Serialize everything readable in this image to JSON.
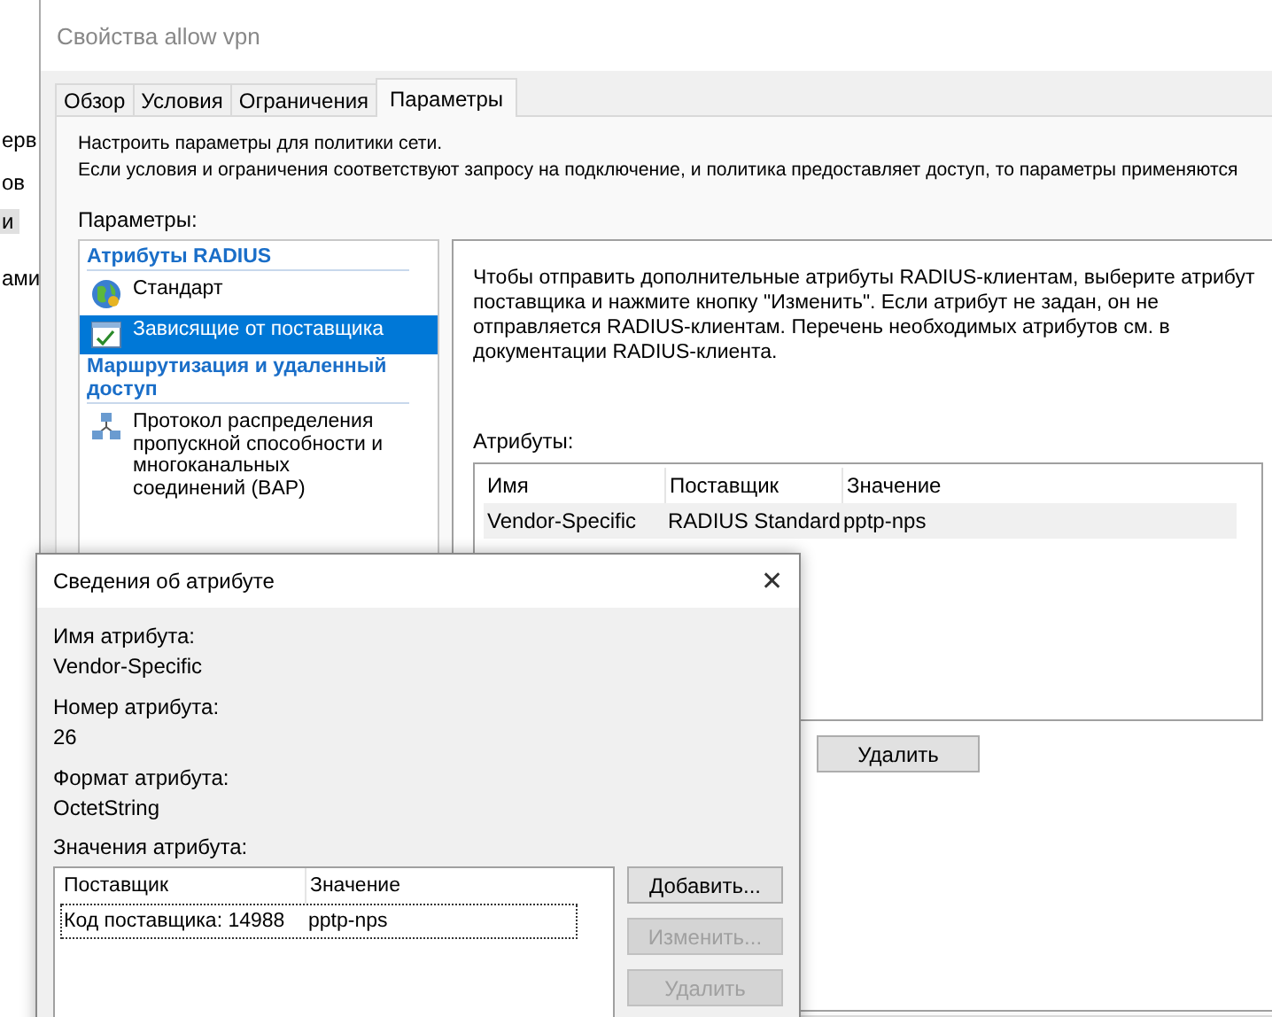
{
  "background_window": {
    "fragments": [
      {
        "text": "ерв",
        "selected": false
      },
      {
        "text": "ов",
        "selected": false
      },
      {
        "text": "и",
        "selected": true
      },
      {
        "text": "ами",
        "selected": false
      }
    ]
  },
  "window": {
    "title": "Свойства allow vpn",
    "tabs": [
      {
        "label": "Обзор",
        "selected": false
      },
      {
        "label": "Условия",
        "selected": false
      },
      {
        "label": "Ограничения",
        "selected": false
      },
      {
        "label": "Параметры",
        "selected": true
      }
    ],
    "intro": [
      "Настроить параметры для политики сети.",
      "Если условия и ограничения соответствуют запросу на подключение, и политика предоставляет доступ, то параметры применяются"
    ],
    "settings_label": "Параметры:",
    "settings_list": [
      {
        "kind": "header",
        "label": "Атрибуты RADIUS"
      },
      {
        "kind": "item",
        "label": "Стандарт",
        "selected": false
      },
      {
        "kind": "item",
        "label": "Зависящие от поставщика",
        "selected": true
      },
      {
        "kind": "header",
        "label": "Маршрутизация и удаленный доступ"
      },
      {
        "kind": "item",
        "label": "Протокол распределения пропускной способности и многоканальных соединений (BAP)",
        "selected": false
      }
    ],
    "detail": {
      "description": "Чтобы отправить дополнительные атрибуты RADIUS-клиентам, выберите атрибут поставщика и нажмите кнопку \"Изменить\". Если атрибут не задан, он не отправляется RADIUS-клиентам. Перечень необходимых атрибутов см. в документации RADIUS-клиента.",
      "attributes_label": "Атрибуты:",
      "columns": [
        "Имя",
        "Поставщик",
        "Значение"
      ],
      "rows": [
        {
          "cells": [
            "Vendor-Specific",
            "RADIUS Standard",
            "pptp-nps"
          ],
          "selected": true
        }
      ],
      "buttons": [
        {
          "label": "Удалить",
          "disabled": false
        }
      ]
    }
  },
  "dialog": {
    "title": "Сведения об атрибуте",
    "close": "✕",
    "fields": [
      {
        "label": "Имя атрибута:",
        "value": "Vendor-Specific"
      },
      {
        "label": "Номер атрибута:",
        "value": "26"
      },
      {
        "label": "Формат атрибута:",
        "value": "OctetString"
      }
    ],
    "values_label": "Значения атрибута:",
    "columns": [
      "Поставщик",
      "Значение"
    ],
    "rows": [
      {
        "cells": [
          "Код поставщика: 14988",
          "pptp-nps"
        ],
        "selected": true
      }
    ],
    "buttons": [
      {
        "label": "Добавить...",
        "disabled": false
      },
      {
        "label": "Изменить...",
        "disabled": true
      },
      {
        "label": "Удалить",
        "disabled": true
      }
    ]
  }
}
